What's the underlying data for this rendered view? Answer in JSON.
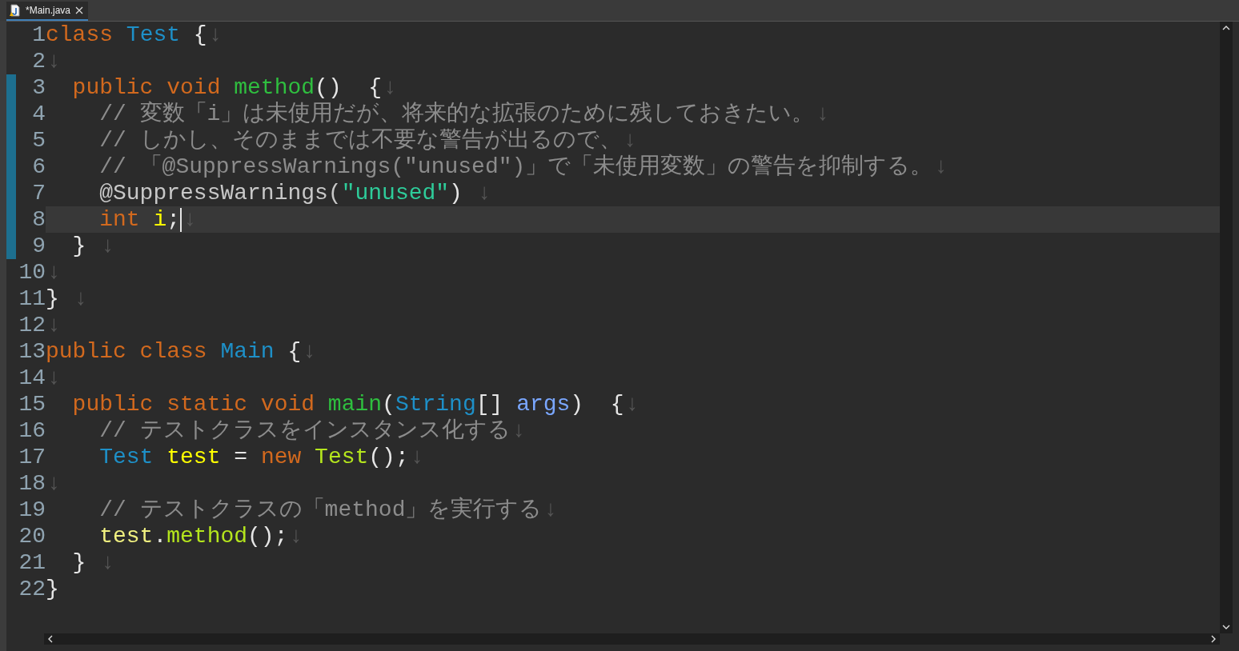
{
  "tab": {
    "label": "*Main.java",
    "selected": true
  },
  "lines": [
    {
      "number": "1",
      "changed": false,
      "current": false,
      "tokens": [
        {
          "text": "class ",
          "kind": "keyword"
        },
        {
          "text": "Test",
          "kind": "type"
        },
        {
          "text": " {",
          "kind": "plain"
        }
      ],
      "eol": "↓"
    },
    {
      "number": "2",
      "changed": false,
      "current": false,
      "eol": "↓"
    },
    {
      "number": "3",
      "changed": true,
      "current": false,
      "tokens": [
        {
          "text": "  public void ",
          "kind": "keyword"
        },
        {
          "text": "method",
          "kind": "method"
        },
        {
          "text": "()  {",
          "kind": "plain"
        }
      ],
      "eol": "↓"
    },
    {
      "number": "4",
      "changed": true,
      "current": false,
      "tokens": [
        {
          "text": "    // 変数「i」は未使用だが、将来的な拡張のために残しておきたい。",
          "kind": "comment"
        }
      ],
      "eol": "↓"
    },
    {
      "number": "5",
      "changed": true,
      "current": false,
      "tokens": [
        {
          "text": "    // しかし、そのままでは不要な警告が出るので、",
          "kind": "comment"
        }
      ],
      "eol": "↓"
    },
    {
      "number": "6",
      "changed": true,
      "current": false,
      "tokens": [
        {
          "text": "    // 「@SuppressWarnings(\"unused\")」で「未使用変数」の警告を抑制する。",
          "kind": "comment"
        }
      ],
      "eol": "↓"
    },
    {
      "number": "7",
      "changed": true,
      "current": false,
      "tokens": [
        {
          "text": "    @SuppressWarnings(",
          "kind": "annotation"
        },
        {
          "text": "\"unused\"",
          "kind": "string"
        },
        {
          "text": ") ",
          "kind": "plain"
        }
      ],
      "eol": "↓"
    },
    {
      "number": "8",
      "changed": true,
      "current": true,
      "tokens": [
        {
          "text": "    int ",
          "kind": "keyword"
        },
        {
          "text": "i",
          "kind": "local"
        },
        {
          "text": ";",
          "kind": "plain"
        }
      ],
      "eol": "↓"
    },
    {
      "number": "9",
      "changed": true,
      "current": false,
      "tokens": [
        {
          "text": "  } ",
          "kind": "plain"
        }
      ],
      "eol": "↓"
    },
    {
      "number": "10",
      "changed": false,
      "current": false,
      "eol": "↓"
    },
    {
      "number": "11",
      "changed": false,
      "current": false,
      "tokens": [
        {
          "text": "} ",
          "kind": "plain"
        }
      ],
      "eol": "↓"
    },
    {
      "number": "12",
      "changed": false,
      "current": false,
      "eol": "↓"
    },
    {
      "number": "13",
      "changed": false,
      "current": false,
      "tokens": [
        {
          "text": "public class ",
          "kind": "keyword"
        },
        {
          "text": "Main",
          "kind": "type"
        },
        {
          "text": " {",
          "kind": "plain"
        }
      ],
      "eol": "↓"
    },
    {
      "number": "14",
      "changed": false,
      "current": false,
      "eol": "↓"
    },
    {
      "number": "15",
      "changed": false,
      "current": false,
      "tokens": [
        {
          "text": "  public static void ",
          "kind": "keyword"
        },
        {
          "text": "main",
          "kind": "method"
        },
        {
          "text": "(",
          "kind": "plain"
        },
        {
          "text": "String",
          "kind": "type"
        },
        {
          "text": "[] ",
          "kind": "plain"
        },
        {
          "text": "args",
          "kind": "param"
        },
        {
          "text": ")  {",
          "kind": "plain"
        }
      ],
      "eol": "↓"
    },
    {
      "number": "16",
      "changed": false,
      "current": false,
      "tokens": [
        {
          "text": "    // テストクラスをインスタンス化する",
          "kind": "comment"
        }
      ],
      "eol": "↓"
    },
    {
      "number": "17",
      "changed": false,
      "current": false,
      "tokens": [
        {
          "text": "    Test ",
          "kind": "type"
        },
        {
          "text": "test",
          "kind": "local"
        },
        {
          "text": " = ",
          "kind": "plain"
        },
        {
          "text": "new ",
          "kind": "keyword"
        },
        {
          "text": "Test",
          "kind": "call"
        },
        {
          "text": "();",
          "kind": "plain"
        }
      ],
      "eol": "↓"
    },
    {
      "number": "18",
      "changed": false,
      "current": false,
      "eol": "↓"
    },
    {
      "number": "19",
      "changed": false,
      "current": false,
      "tokens": [
        {
          "text": "    // テストクラスの「method」を実行する",
          "kind": "comment"
        }
      ],
      "eol": "↓"
    },
    {
      "number": "20",
      "changed": false,
      "current": false,
      "tokens": [
        {
          "text": "    test",
          "kind": "localuse"
        },
        {
          "text": ".",
          "kind": "plain"
        },
        {
          "text": "method",
          "kind": "call"
        },
        {
          "text": "();",
          "kind": "plain"
        }
      ],
      "eol": "↓"
    },
    {
      "number": "21",
      "changed": false,
      "current": false,
      "tokens": [
        {
          "text": "  } ",
          "kind": "plain"
        }
      ],
      "eol": "↓"
    },
    {
      "number": "22",
      "changed": false,
      "current": false,
      "tokens": [
        {
          "text": "}",
          "kind": "plain"
        }
      ]
    }
  ]
}
